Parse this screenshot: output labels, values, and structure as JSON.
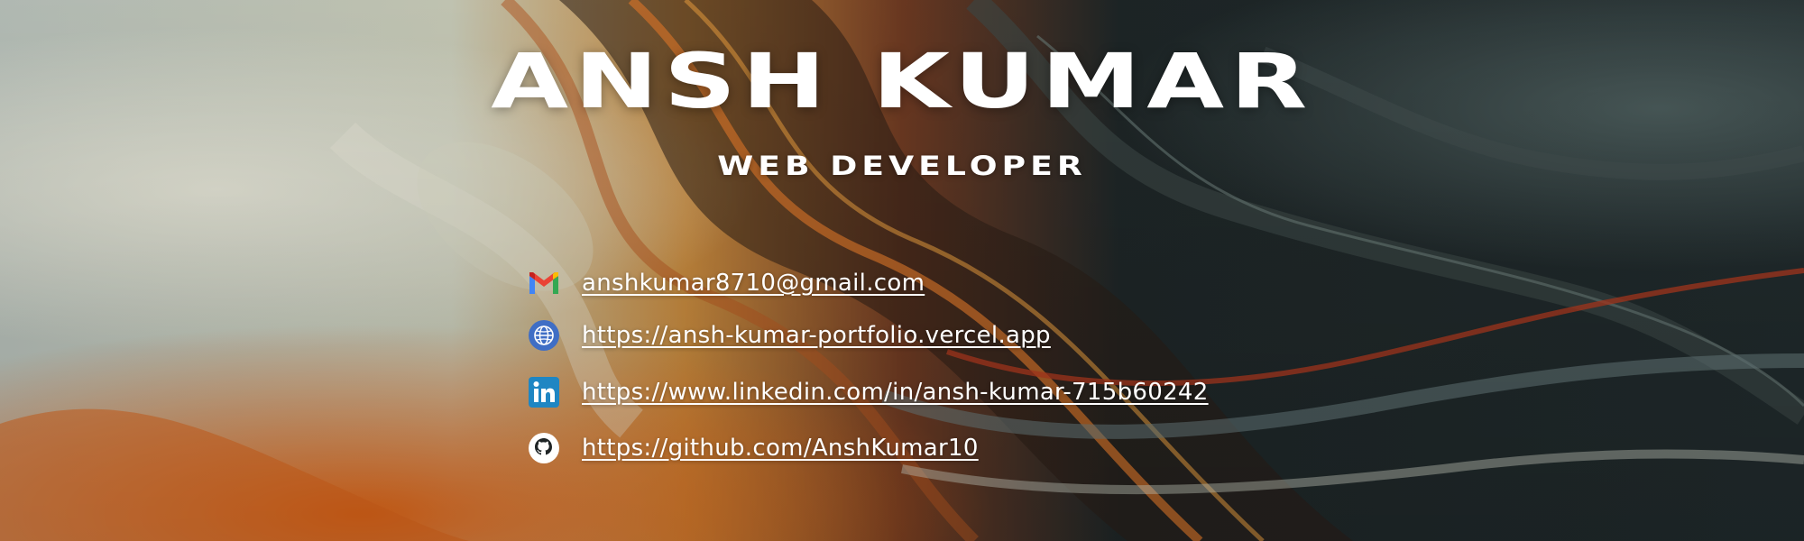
{
  "header": {
    "name": "ANSH KUMAR",
    "title": "WEB DEVELOPER"
  },
  "contacts": [
    {
      "icon": "gmail-icon",
      "text": "anshkumar8710@gmail.com"
    },
    {
      "icon": "globe-icon",
      "text": "https://ansh-kumar-portfolio.vercel.app"
    },
    {
      "icon": "linkedin-icon",
      "text": "https://www.linkedin.com/in/ansh-kumar-715b60242"
    },
    {
      "icon": "github-icon",
      "text": "https://github.com/AnshKumar10"
    }
  ],
  "colors": {
    "text": "#ffffff",
    "background_dark": "#1b2224",
    "accent_orange": "#d4631e",
    "accent_cream": "#d9d3bd"
  }
}
